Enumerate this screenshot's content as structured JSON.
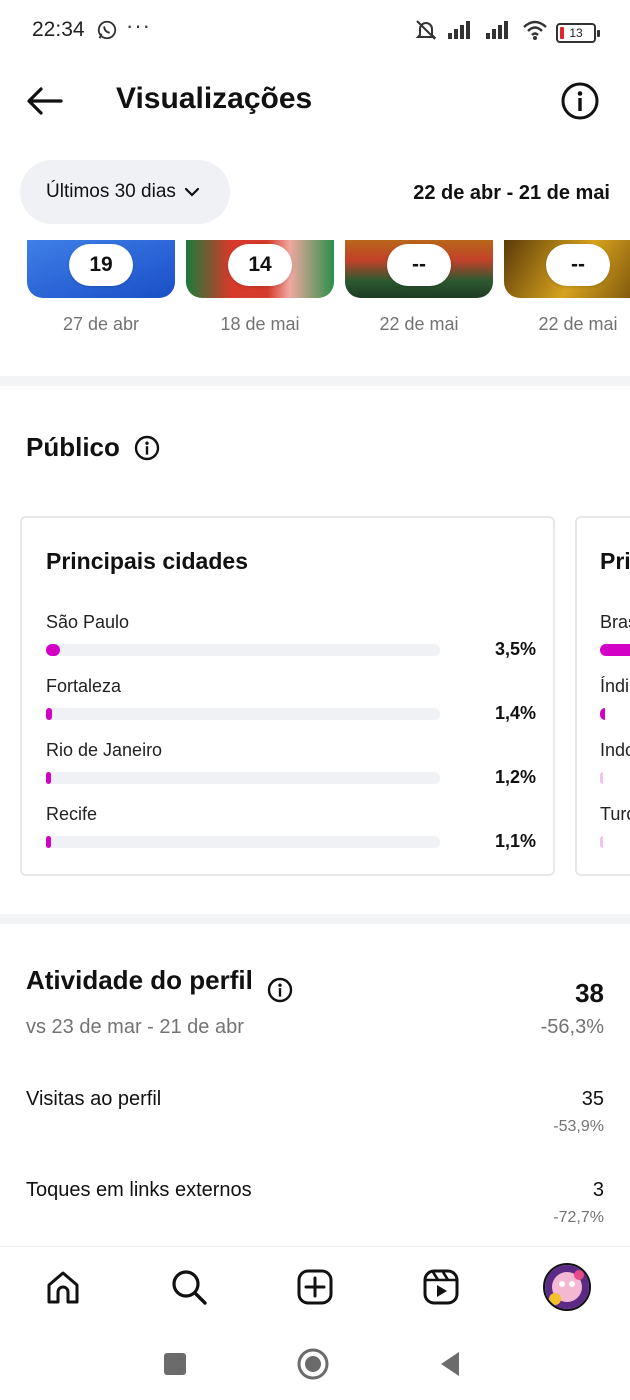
{
  "status": {
    "time": "22:34",
    "battery": "13"
  },
  "header": {
    "title": "Visualizações"
  },
  "filter": {
    "range_label": "Últimos 30 dias",
    "date_range": "22 de abr - 21 de mai"
  },
  "thumbnails": [
    {
      "count": "19",
      "date": "27 de abr"
    },
    {
      "count": "14",
      "date": "18 de mai"
    },
    {
      "count": "--",
      "date": "22 de mai"
    },
    {
      "count": "--",
      "date": "22 de mai"
    }
  ],
  "audience": {
    "title": "Público",
    "cities_card": {
      "title": "Principais cidades",
      "rows": [
        {
          "name": "São Paulo",
          "pct": "3,5%",
          "value": 3.5
        },
        {
          "name": "Fortaleza",
          "pct": "1,4%",
          "value": 1.4
        },
        {
          "name": "Rio de Janeiro",
          "pct": "1,2%",
          "value": 1.2
        },
        {
          "name": "Recife",
          "pct": "1,1%",
          "value": 1.1
        }
      ]
    },
    "countries_card": {
      "title": "Pri",
      "rows": [
        "Bras",
        "Índi",
        "Indo",
        "Turq"
      ]
    }
  },
  "activity": {
    "title": "Atividade do perfil",
    "total": "38",
    "compare": "vs 23 de mar - 21 de abr",
    "change": "-56,3%",
    "rows": [
      {
        "label": "Visitas ao perfil",
        "value": "35",
        "change": "-53,9%"
      },
      {
        "label": "Toques em links externos",
        "value": "3",
        "change": "-72,7%"
      }
    ]
  },
  "colors": {
    "accent": "#d300c5",
    "chip_bg": "#eff1f4",
    "muted": "#737373"
  }
}
